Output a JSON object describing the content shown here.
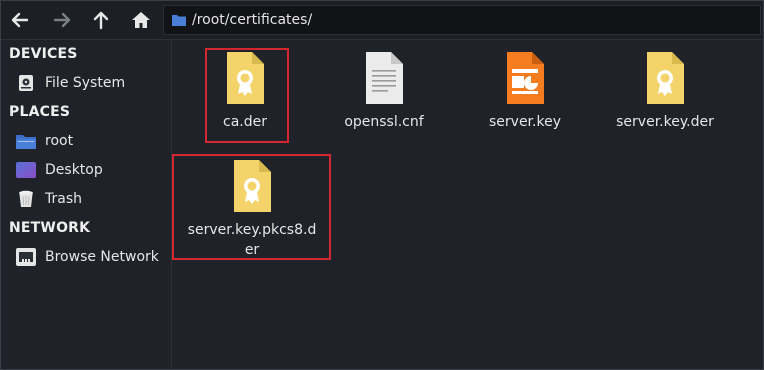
{
  "toolbar": {
    "back_icon": "arrow-left-icon",
    "forward_icon": "arrow-right-icon",
    "up_icon": "arrow-up-icon",
    "home_icon": "home-icon",
    "path": "/root/certificates/"
  },
  "sidebar": {
    "sections": [
      {
        "title": "DEVICES",
        "items": [
          {
            "label": "File System",
            "icon": "drive-icon"
          }
        ]
      },
      {
        "title": "PLACES",
        "items": [
          {
            "label": "root",
            "icon": "folder-icon"
          },
          {
            "label": "Desktop",
            "icon": "desktop-icon"
          },
          {
            "label": "Trash",
            "icon": "trash-icon"
          }
        ]
      },
      {
        "title": "NETWORK",
        "items": [
          {
            "label": "Browse Network",
            "icon": "network-icon"
          }
        ]
      }
    ]
  },
  "files": [
    {
      "name": "ca.der",
      "icon": "certificate-icon",
      "highlighted": true
    },
    {
      "name": "openssl.cnf",
      "icon": "text-file-icon",
      "highlighted": false
    },
    {
      "name": "server.key",
      "icon": "key-file-icon",
      "highlighted": false
    },
    {
      "name": "server.key.der",
      "icon": "certificate-icon",
      "highlighted": false
    },
    {
      "name": "server.key.pkcs8.der",
      "icon": "certificate-icon",
      "highlighted": true
    }
  ],
  "colors": {
    "background": "#1f2329",
    "certificate": "#f3d36a",
    "key_file": "#f57c1f",
    "highlight": "#d6262f",
    "folder_blue": "#4a7fd8"
  }
}
